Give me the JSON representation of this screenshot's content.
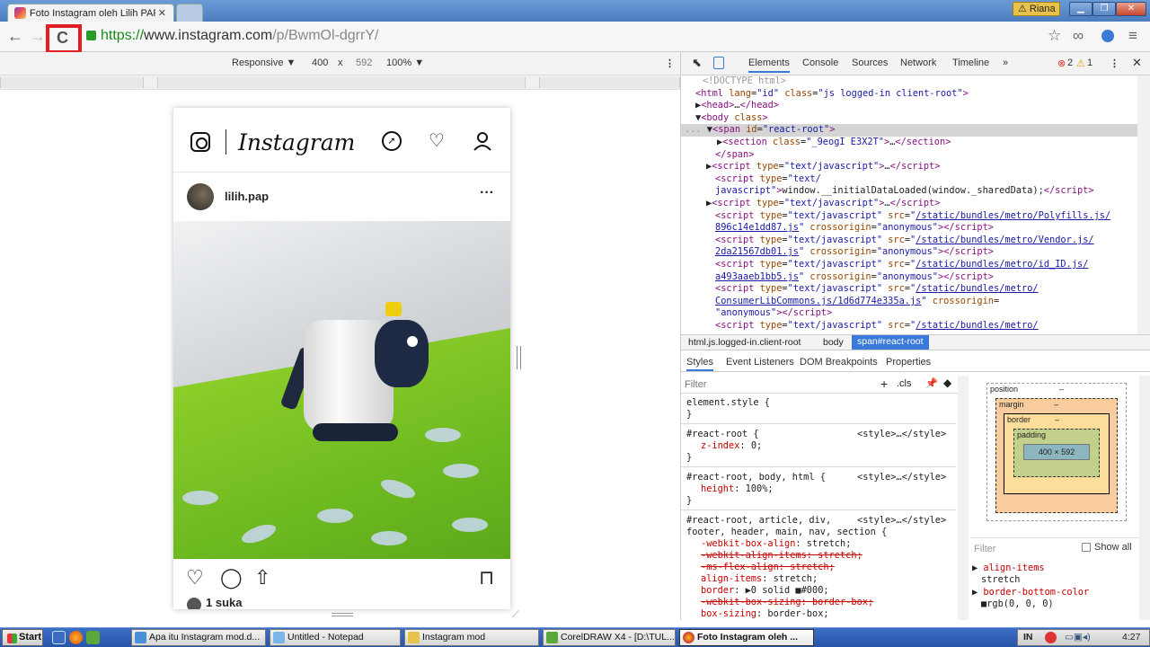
{
  "browser": {
    "tab_title": "Foto Instagram oleh Lilih PAP",
    "tab_close": "✕",
    "window_user": "Riana",
    "url_scheme": "https://",
    "url_host": "www.instagram.com",
    "url_path": "/p/BwmOl-dgrrY/",
    "back": "←",
    "forward": "→",
    "reload": "C"
  },
  "device_toolbar": {
    "mode": "Responsive ▼",
    "width": "400",
    "times": "x",
    "height": "592",
    "zoom": "100% ▼",
    "more": "⋮"
  },
  "instagram": {
    "logo": "Instagram",
    "username": "lilih.pap",
    "more": "···",
    "likes": "1 suka"
  },
  "devtools": {
    "tabs": [
      "Elements",
      "Console",
      "Sources",
      "Network",
      "Timeline",
      "»"
    ],
    "errors": "2",
    "warnings": "1",
    "breadcrumbs": [
      "html.js.logged-in.client-root",
      "body",
      "span#react-root"
    ],
    "subtabs": [
      "Styles",
      "Event Listeners",
      "DOM Breakpoints",
      "Properties"
    ],
    "filter_placeholder": "Filter",
    "cls": ".cls",
    "plus": "+",
    "computed_filter": "Filter",
    "show_all": "Show all",
    "box_model": {
      "position": "position",
      "margin": "margin",
      "border": "border",
      "padding": "padding",
      "content": "400 × 592",
      "dash": "–"
    }
  },
  "taskbar": {
    "start": "Start",
    "buttons": [
      "Apa itu Instagram mod.d...",
      "Untitled - Notepad",
      "Instagram mod",
      "CorelDRAW X4 - [D:\\TUL...",
      "Foto Instagram oleh ..."
    ],
    "lang": "IN",
    "clock": "4:27"
  },
  "colors": {
    "highlight": "#e02020",
    "devtools_accent": "#3879d9"
  }
}
